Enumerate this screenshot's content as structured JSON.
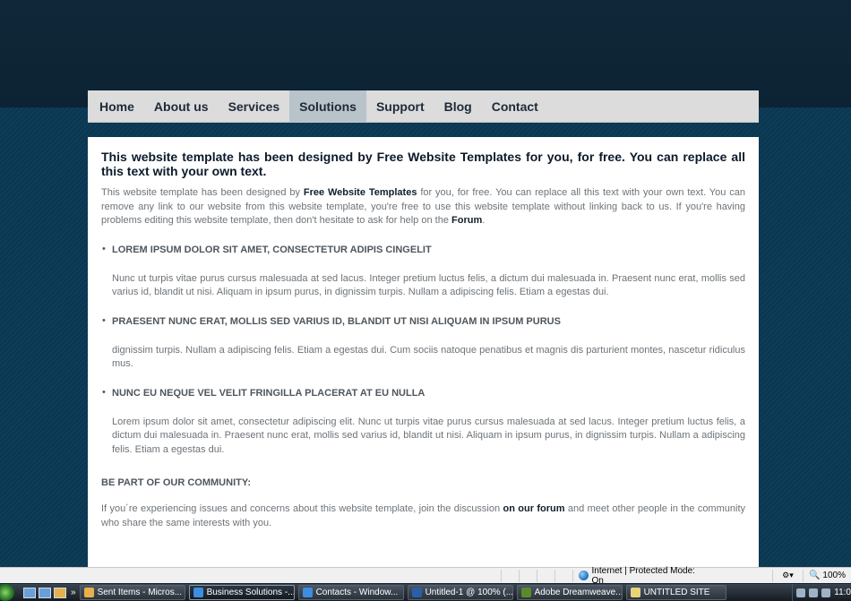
{
  "nav": {
    "items": [
      {
        "label": "Home"
      },
      {
        "label": "About us"
      },
      {
        "label": "Services"
      },
      {
        "label": "Solutions",
        "active": true
      },
      {
        "label": "Support"
      },
      {
        "label": "Blog"
      },
      {
        "label": "Contact"
      }
    ]
  },
  "content": {
    "headline": "This website template has been designed by Free Website Templates for you, for free. You can replace all this text with your own text.",
    "intro": {
      "part1": "This website template has been designed by ",
      "link1": "Free Website Templates",
      "part2": " for you, for free. You can replace all this text with your own text. You can remove any link to our website from this website template, you're free to use this website template without linking back to us. If you're having problems editing this website template, then don't hesitate to ask for help on the ",
      "link2": "Forum",
      "part3": "."
    },
    "list": [
      {
        "title": "LOREM IPSUM DOLOR SIT AMET, CONSECTETUR ADIPIS CINGELIT",
        "text": "Nunc ut turpis vitae purus cursus malesuada at sed lacus. Integer pretium luctus felis, a dictum dui malesuada in. Praesent nunc erat, mollis sed varius id, blandit ut nisi. Aliquam in ipsum purus, in dignissim turpis. Nullam a adipiscing felis. Etiam a egestas dui."
      },
      {
        "title": "PRAESENT NUNC ERAT, MOLLIS SED VARIUS ID, BLANDIT UT NISI ALIQUAM IN IPSUM PURUS",
        "text": "dignissim turpis. Nullam a adipiscing felis. Etiam a egestas dui. Cum sociis natoque penatibus et magnis dis parturient montes, nascetur ridiculus mus."
      },
      {
        "title": "NUNC EU NEQUE VEL VELIT FRINGILLA PLACERAT AT EU NULLA",
        "text": "Lorem ipsum dolor sit amet, consectetur adipiscing elit. Nunc ut turpis vitae purus cursus malesuada at sed lacus. Integer pretium luctus felis, a dictum dui malesuada in. Praesent nunc erat, mollis sed varius id, blandit ut nisi. Aliquam in ipsum purus, in dignissim turpis. Nullam a adipiscing felis. Etiam a egestas dui."
      }
    ],
    "community": {
      "heading": "BE PART OF OUR COMMUNITY:",
      "part1": "If you´re experiencing issues and concerns about this website template, join the discussion ",
      "link": "on our forum",
      "part2": " and meet other people in the community who share the same interests with you."
    }
  },
  "statusbar": {
    "zone": "Internet | Protected Mode: On",
    "zoom": "100%"
  },
  "taskbar": {
    "quicklaunch_more": "»",
    "tasks": [
      {
        "label": "Sent Items - Micros...",
        "icon": "outlook-icon",
        "color": "#e8b04a"
      },
      {
        "label": "Business Solutions -...",
        "icon": "ie-icon",
        "color": "#3d8ee0",
        "active": true
      },
      {
        "label": "Contacts - Window...",
        "icon": "ie-icon",
        "color": "#3d8ee0"
      },
      {
        "label": "Untitled-1 @ 100% (...",
        "icon": "photoshop-icon",
        "color": "#2a5ea8"
      },
      {
        "label": "Adobe Dreamweave...",
        "icon": "dreamweaver-icon",
        "color": "#5a8a2a"
      },
      {
        "label": "UNTITLED SITE",
        "icon": "folder-icon",
        "color": "#e9d27a"
      }
    ],
    "clock": "11:0"
  }
}
